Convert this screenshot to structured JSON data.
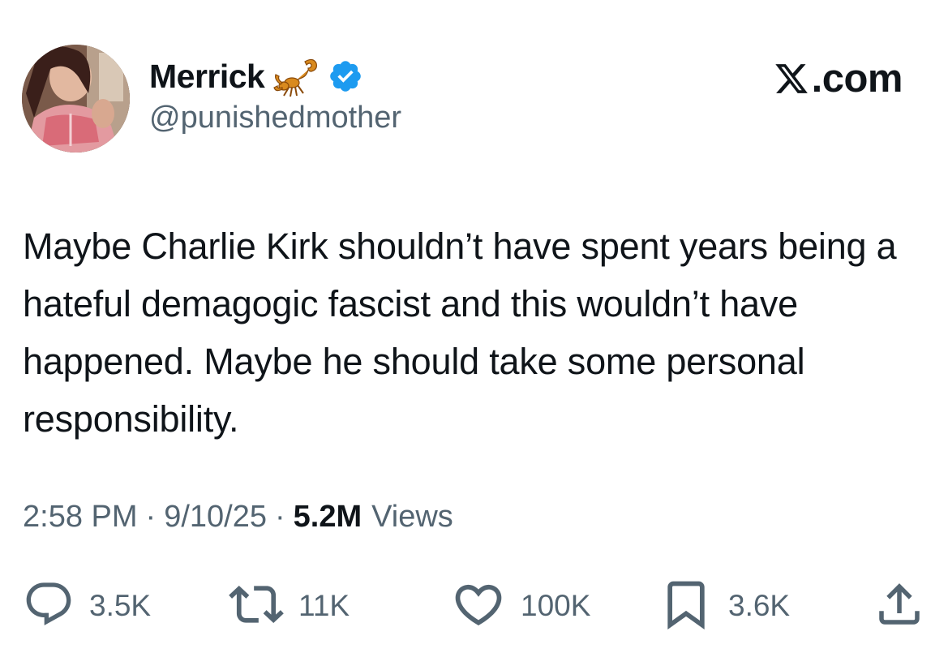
{
  "author": {
    "display_name": "Merrick",
    "handle": "@punishedmother",
    "name_emoji": "scorpion-icon",
    "verified": true,
    "verified_color": "#1d9bf0"
  },
  "brand": {
    "logo": "x-logo-icon",
    "text": ".com"
  },
  "tweet": {
    "text": "Maybe Charlie Kirk shouldn’t have spent years being a hateful demagogic fascist and this wouldn’t have happened. Maybe he should take some personal responsibility."
  },
  "meta": {
    "time": "2:58 PM",
    "separator": "·",
    "date": "9/10/25",
    "views_count": "5.2M",
    "views_label": "Views"
  },
  "actions": {
    "replies": "3.5K",
    "reposts": "11K",
    "likes": "100K",
    "bookmarks": "3.6K",
    "icons": [
      "reply-icon",
      "repost-icon",
      "like-icon",
      "bookmark-icon",
      "share-icon"
    ],
    "icon_color": "#536471"
  },
  "colors": {
    "text_primary": "#0f1419",
    "text_secondary": "#536471",
    "background": "#ffffff"
  }
}
